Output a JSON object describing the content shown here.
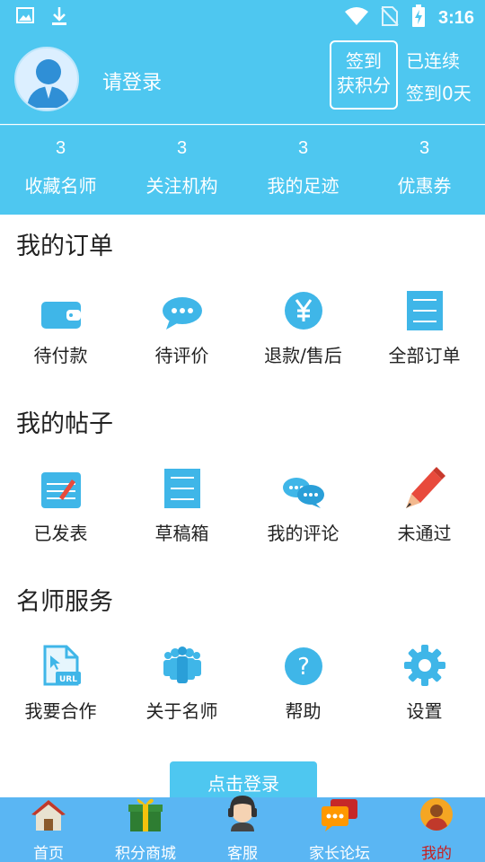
{
  "status": {
    "time": "3:16"
  },
  "header": {
    "login_text": "请登录",
    "sign_line1": "签到",
    "sign_line2": "获积分",
    "streak_line1": "已连续",
    "streak_line2": "签到0天"
  },
  "stats": [
    {
      "num": "3",
      "label": "收藏名师"
    },
    {
      "num": "3",
      "label": "关注机构"
    },
    {
      "num": "3",
      "label": "我的足迹"
    },
    {
      "num": "3",
      "label": "优惠券"
    }
  ],
  "orders": {
    "title": "我的订单",
    "items": [
      "待付款",
      "待评价",
      "退款/售后",
      "全部订单"
    ]
  },
  "posts": {
    "title": "我的帖子",
    "items": [
      "已发表",
      "草稿箱",
      "我的评论",
      "未通过"
    ]
  },
  "services": {
    "title": "名师服务",
    "items": [
      "我要合作",
      "关于名师",
      "帮助",
      "设置"
    ]
  },
  "login_button": "点击登录",
  "tabbar": {
    "items": [
      "首页",
      "积分商城",
      "客服",
      "家长论坛",
      "我的"
    ],
    "active": "我的"
  },
  "colors": {
    "primary": "#4ec7f0",
    "tabbar": "#5ab6f3",
    "active_tab": "#c81e1e",
    "icon_blue": "#3fb6e8",
    "icon_red": "#e84a3c"
  }
}
